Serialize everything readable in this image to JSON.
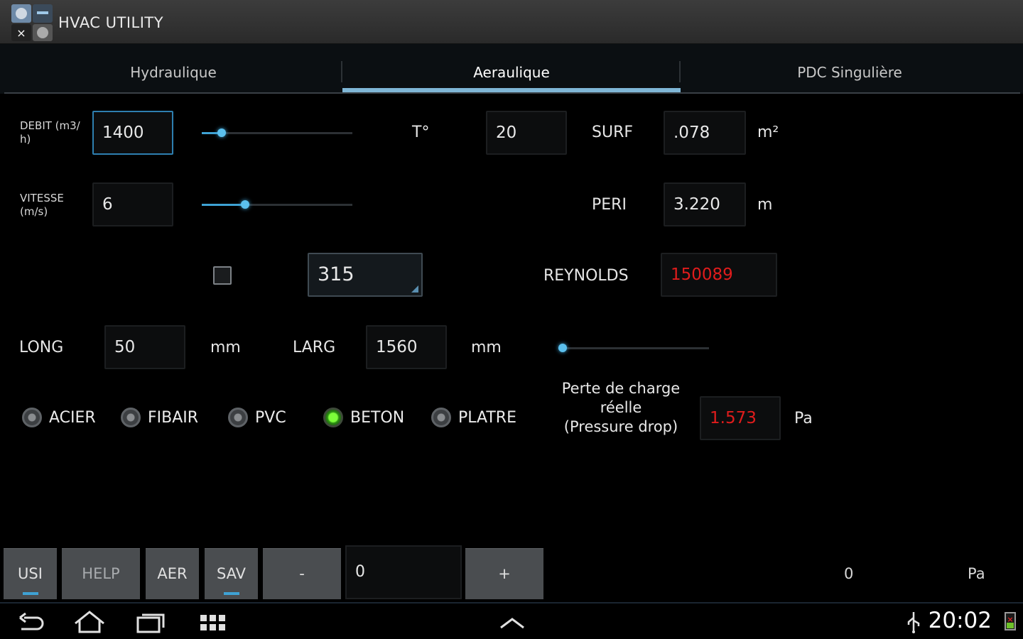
{
  "app": {
    "title": "HVAC UTILITY"
  },
  "tabs": [
    {
      "label": "Hydraulique"
    },
    {
      "label": "Aeraulique"
    },
    {
      "label": "PDC Singulière"
    }
  ],
  "form": {
    "debit": {
      "label_line1": "DEBIT (m3/",
      "label_line2": "h)",
      "value": "1400",
      "slider_level": 0.13
    },
    "vitesse": {
      "label_line1": "VITESSE",
      "label_line2": "(m/s)",
      "value": "6",
      "slider_level": 0.29
    },
    "temperature": {
      "label": "T°",
      "value": "20"
    },
    "surf": {
      "label": "SURF",
      "value": ".078",
      "unit": "m²"
    },
    "peri": {
      "label": "PERI",
      "value": "3.220",
      "unit": "m"
    },
    "diameter": {
      "value": "315",
      "checked": false
    },
    "reynolds": {
      "label": "REYNOLDS",
      "value": "150089"
    },
    "long": {
      "label": "LONG",
      "value": "50",
      "unit": "mm"
    },
    "larg": {
      "label": "LARG",
      "value": "1560",
      "unit": "mm"
    },
    "third_slider_level": 0.03,
    "pressure_drop": {
      "label_line1": "Perte de charge",
      "label_line2": "réelle",
      "label_line3": "(Pressure drop)",
      "value": "1.573",
      "unit": "Pa"
    }
  },
  "materials": [
    {
      "label": "ACIER",
      "checked": false
    },
    {
      "label": "FIBAIR",
      "checked": false
    },
    {
      "label": "PVC",
      "checked": false
    },
    {
      "label": "BETON",
      "checked": true
    },
    {
      "label": "PLATRE",
      "checked": false
    }
  ],
  "bottom": {
    "usi": "USI",
    "help": "HELP",
    "aer": "AER",
    "sav": "SAV",
    "minus": "-",
    "counter_value": "0",
    "plus": "+",
    "total_value": "0",
    "total_unit": "Pa"
  },
  "status": {
    "time": "20:02"
  },
  "colors": {
    "accent": "#3ea2d4",
    "tab_underline": "#7fb6d6",
    "error_red": "#e01c1c",
    "radio_on": "#7dff3a"
  }
}
